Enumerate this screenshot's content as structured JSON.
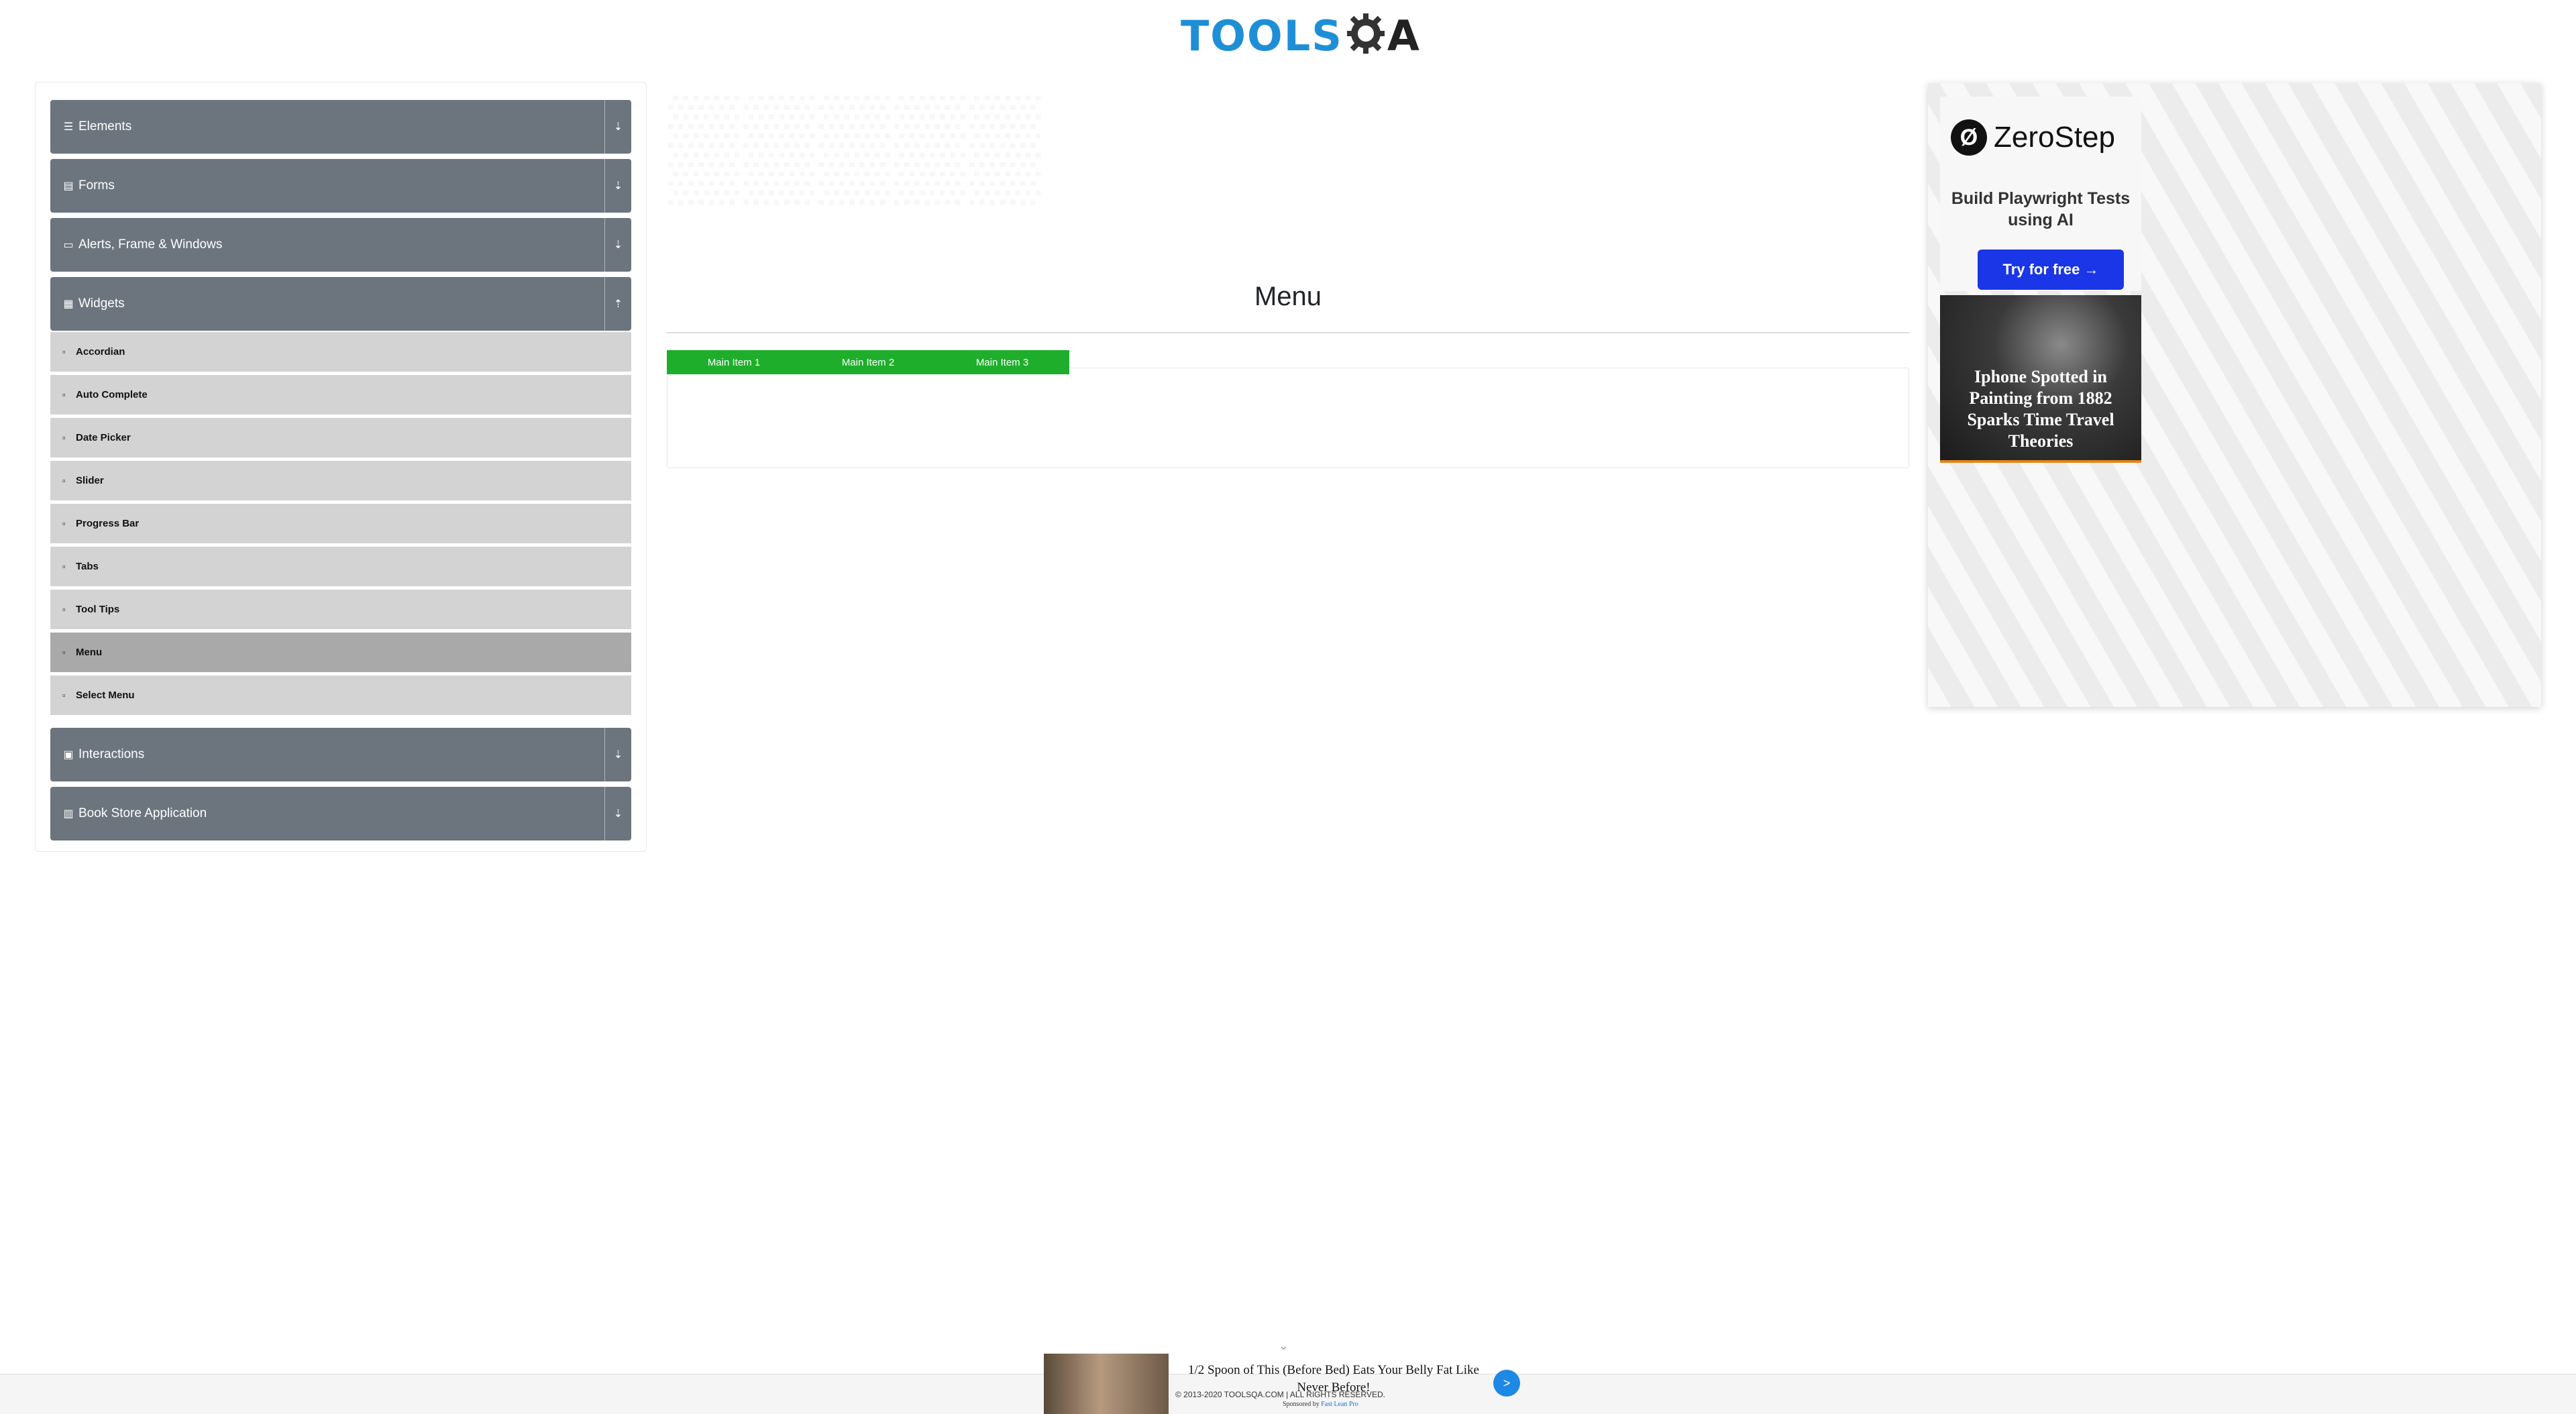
{
  "header": {
    "logo_text": "TOOLSQA",
    "logo_word": "TOOLS",
    "logo_a": "A"
  },
  "sidebar": {
    "groups": [
      {
        "label": "Elements",
        "icon": "list-icon",
        "expanded": false
      },
      {
        "label": "Forms",
        "icon": "form-icon",
        "expanded": false
      },
      {
        "label": "Alerts, Frame & Windows",
        "icon": "window-icon",
        "expanded": false
      },
      {
        "label": "Widgets",
        "icon": "grid-icon",
        "expanded": true
      },
      {
        "label": "Interactions",
        "icon": "interaction-icon",
        "expanded": false
      },
      {
        "label": "Book Store Application",
        "icon": "book-icon",
        "expanded": false
      }
    ],
    "widget_items": [
      "Accordian",
      "Auto Complete",
      "Date Picker",
      "Slider",
      "Progress Bar",
      "Tabs",
      "Tool Tips",
      "Menu",
      "Select Menu"
    ],
    "active_item": "Menu"
  },
  "main": {
    "title": "Menu",
    "menu_items": [
      "Main Item 1",
      "Main Item 2",
      "Main Item 3"
    ],
    "menu_color": "#1fae2b"
  },
  "ad": {
    "brand": "ZeroStep",
    "tagline": "Build Playwright Tests using AI",
    "cta": "Try for free →",
    "cta_color": "#1a36e6",
    "news_headline": "Iphone Spotted in Painting from 1882 Sparks Time Travel Theories"
  },
  "footer": {
    "copyright": "© 2013-2020 TOOLSQA.COM | ALL RIGHTS RESERVED.",
    "bottom_ad_headline": "1/2 Spoon of This (Before Bed) Eats Your Belly Fat Like Never Before!",
    "sponsored_prefix": "Sponsored by",
    "sponsored_brand": "Fast Lean Pro",
    "go_label": ">"
  },
  "colors": {
    "sidebar_header": "#6c757d",
    "sidebar_item": "#d3d3d3",
    "active_item": "#a9a9a9",
    "logo_blue": "#1e8fd6"
  }
}
